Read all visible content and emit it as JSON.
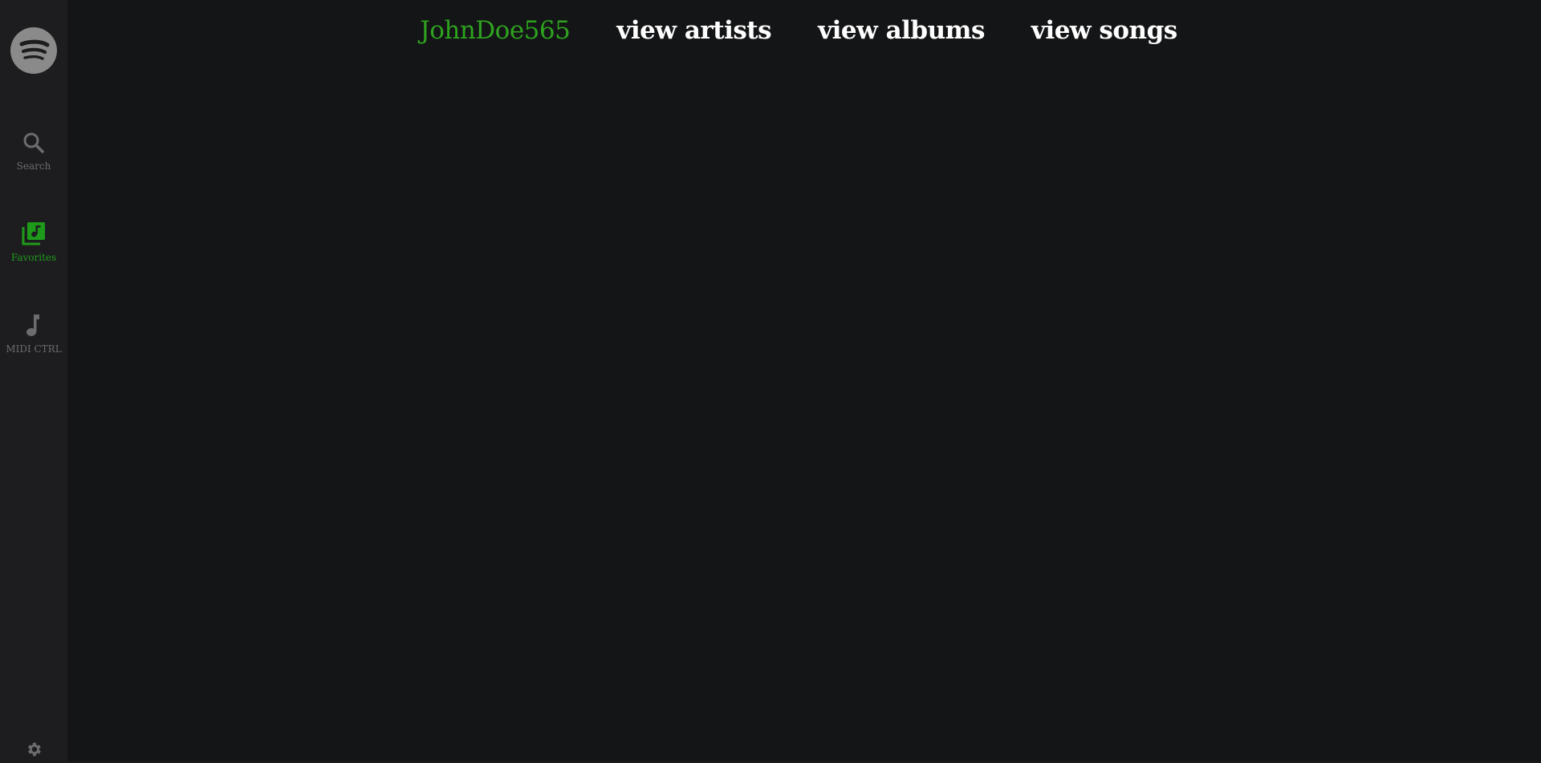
{
  "colors": {
    "accent": "#2ea31f",
    "sidebar_bg": "#1d1d1f",
    "main_bg": "#141517",
    "inactive": "#6c6c6e"
  },
  "sidebar": {
    "logo_icon": "spotify-logo-icon",
    "items": [
      {
        "label": "Search",
        "icon": "search-icon",
        "active": false
      },
      {
        "label": "Favorites",
        "icon": "music-library-icon",
        "active": true
      },
      {
        "label": "MIDI CTRL",
        "icon": "music-note-icon",
        "active": false
      }
    ],
    "settings_icon": "gear-icon"
  },
  "header": {
    "username": "JohnDoe565",
    "links": [
      "view artists",
      "view albums",
      "view songs"
    ]
  }
}
